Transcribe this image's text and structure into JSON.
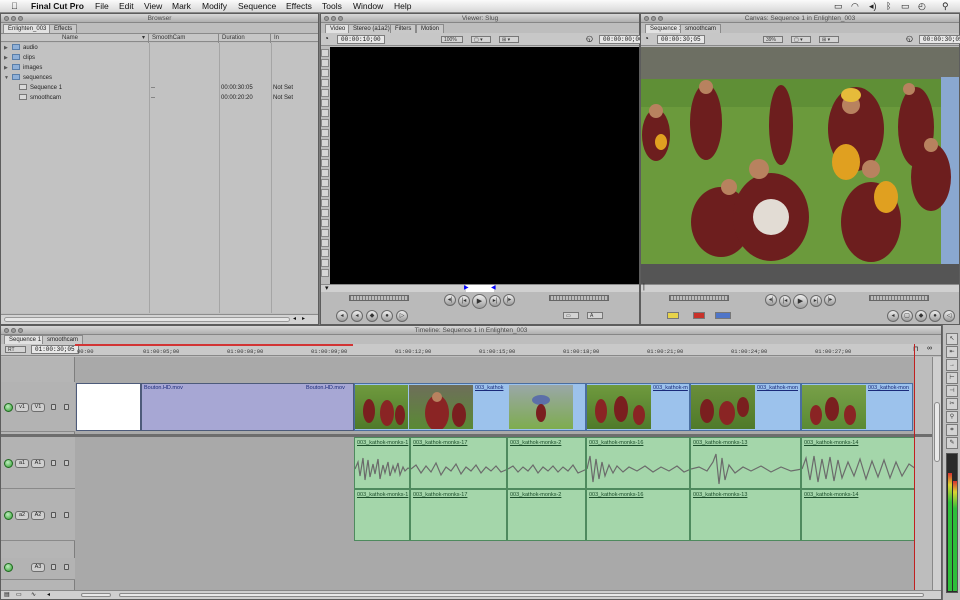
{
  "menubar": {
    "app": "Final Cut Pro",
    "items": [
      "File",
      "Edit",
      "View",
      "Mark",
      "Modify",
      "Sequence",
      "Effects",
      "Tools",
      "Window",
      "Help"
    ]
  },
  "browser": {
    "title": "Browser",
    "tabs": [
      "Enlighten_003",
      "Effects"
    ],
    "columns": [
      "Name",
      "SmoothCam",
      "Duration",
      "In"
    ],
    "rows": [
      {
        "name": "audio",
        "kind": "folder",
        "smooth": "",
        "duration": "",
        "in": ""
      },
      {
        "name": "clips",
        "kind": "folder",
        "smooth": "",
        "duration": "",
        "in": ""
      },
      {
        "name": "images",
        "kind": "folder",
        "smooth": "",
        "duration": "",
        "in": ""
      },
      {
        "name": "sequences",
        "kind": "folder",
        "smooth": "",
        "duration": "",
        "in": ""
      },
      {
        "name": "Sequence 1",
        "kind": "sequence",
        "smooth": "--",
        "duration": "00:00:30:05",
        "in": "Not Set"
      },
      {
        "name": "smoothcam",
        "kind": "sequence",
        "smooth": "--",
        "duration": "00:00:20:20",
        "in": "Not Set"
      }
    ]
  },
  "viewer": {
    "title": "Viewer: Slug",
    "tabs": [
      "Video",
      "Stereo (a1a2)",
      "Filters",
      "Motion"
    ],
    "timecode_left": "00:00:10;00",
    "timecode_right": "00:00:00;00",
    "zoom": "100%"
  },
  "canvas": {
    "title": "Canvas: Sequence 1 in Enlighten_003",
    "tabs": [
      "Sequence 1",
      "smoothcam"
    ],
    "timecode_left": "00:00:30;05",
    "timecode_right": "00:00:30;05",
    "zoom": "39%"
  },
  "timeline": {
    "title": "Timeline: Sequence 1 in Enlighten_003",
    "tabs": [
      "Sequence 1",
      "smoothcam"
    ],
    "render_label": "RT",
    "current_timecode": "01:00:30;05",
    "ruler": [
      "00:00",
      "01:00:05;00",
      "01:00:08;00",
      "01:00:09;00",
      "01:00:12;00",
      "01:00:15;00",
      "01:00:18;00",
      "01:00:21;00",
      "01:00:24;00",
      "01:00:27;00"
    ],
    "tracks": {
      "v1": {
        "src": "v1",
        "dst": "V1"
      },
      "a1": {
        "src": "a1",
        "dst": "A1"
      },
      "a2": {
        "src": "a2",
        "dst": "A2"
      },
      "a3": {
        "dst": "A3"
      }
    },
    "video_clips": {
      "bouton_name": "Bouton.HD.mov",
      "bouton_name2": "Bouton.HD.mov",
      "c1": "003_kathok",
      "c2": "003_kathok-m",
      "c3": "003_kathok-mon",
      "c4": "003_kathok-mon",
      "c5": "003_kathok-mon"
    },
    "audio_clips_a1": [
      "003_kathok-monks-1",
      "003_kathok-monks-17",
      "003_kathok-monks-2",
      "003_kathok-monks-16",
      "003_kathok-monks-13",
      "003_kathok-monks-14"
    ],
    "audio_clips_a2": [
      "003_kathok-monks-1",
      "003_kathok-monks-17",
      "003_kathok-monks-2",
      "003_kathok-monks-16",
      "003_kathok-monks-13",
      "003_kathok-monks-14"
    ]
  },
  "colors": {
    "video_clip": "#9cc2ec",
    "audio_clip": "#a4d6aa",
    "graphic_clip": "#a7a7d4",
    "canvas_bg": "#000000"
  }
}
